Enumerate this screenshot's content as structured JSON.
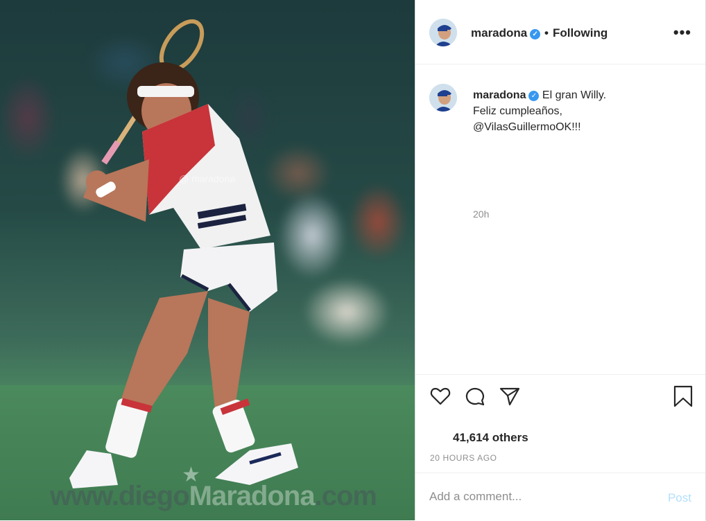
{
  "header": {
    "username": "maradona",
    "separator": "•",
    "follow_status": "Following",
    "more_label": "•••"
  },
  "caption": {
    "username": "maradona",
    "line1": "El gran Willy.",
    "line2": "Feliz cumpleaños,",
    "mention": "@VilasGuillermoOK!!!",
    "time": "20h"
  },
  "media": {
    "watermark_small": "@ maradona",
    "watermark_big_part1": "www.diego",
    "watermark_big_part2": "Maradona",
    "watermark_big_part3": ".com",
    "star": "★"
  },
  "stats": {
    "likes": "41,614 others",
    "post_time": "20 HOURS AGO"
  },
  "comment": {
    "placeholder": "Add a comment...",
    "post_label": "Post"
  },
  "icons": {
    "verified": "verified-badge-icon",
    "like": "heart-icon",
    "comment": "comment-icon",
    "share": "paper-plane-icon",
    "save": "bookmark-icon"
  },
  "colors": {
    "verified_blue": "#3897f0",
    "post_button": "#b2dffc",
    "muted_text": "#8e8e8e"
  }
}
